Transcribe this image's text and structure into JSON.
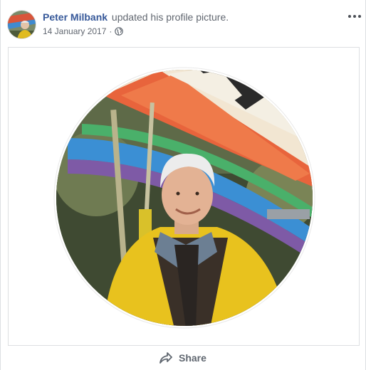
{
  "post": {
    "author": "Peter Milbank",
    "action": "updated his profile picture.",
    "date": "14 January 2017",
    "separator": "·",
    "privacy_icon": "globe-icon",
    "more_icon": "more-options-icon",
    "share_label": "Share",
    "share_icon": "share-arrow-icon"
  },
  "colors": {
    "author_link": "#365899",
    "secondary_text": "#616770",
    "border": "#dddfe2",
    "glider_orange": "#e8643c",
    "glider_blue": "#3b8fd4",
    "jacket_yellow": "#e8c21e"
  }
}
